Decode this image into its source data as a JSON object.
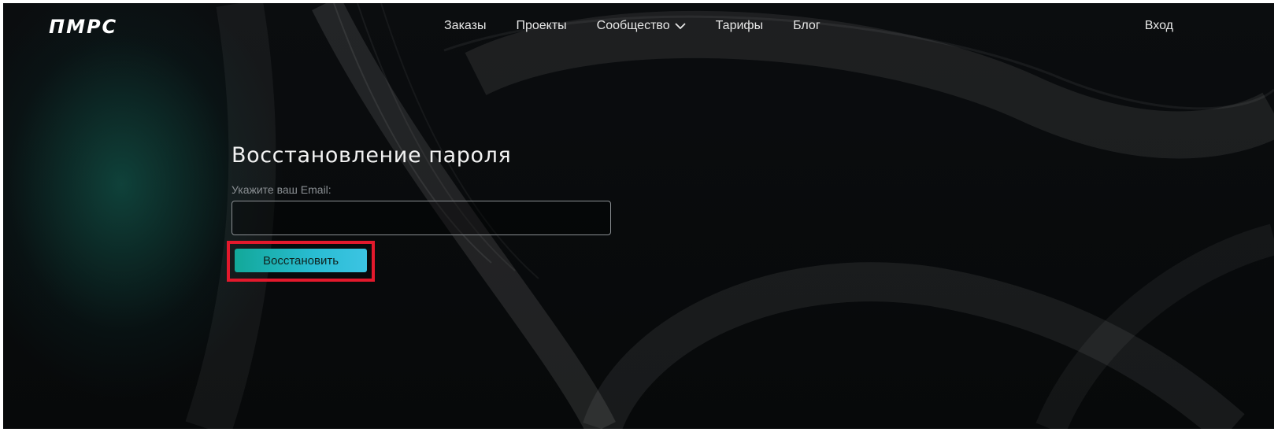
{
  "header": {
    "logo_text": "ПМРС",
    "menu": [
      {
        "label": "Заказы"
      },
      {
        "label": "Проекты"
      },
      {
        "label": "Сообщество",
        "has_dropdown": true
      },
      {
        "label": "Тарифы"
      },
      {
        "label": "Блог"
      }
    ],
    "login_label": "Вход"
  },
  "form": {
    "title": "Восстановление пароля",
    "email_label": "Укажите ваш Email:",
    "email_value": "",
    "submit_label": "Восстановить"
  },
  "colors": {
    "background": "#07090a",
    "accent_gradient_start": "#12a899",
    "accent_gradient_end": "#3cc4e3",
    "highlight_border": "#e3192c"
  },
  "icons": {
    "dropdown": "chevron-down-icon"
  }
}
